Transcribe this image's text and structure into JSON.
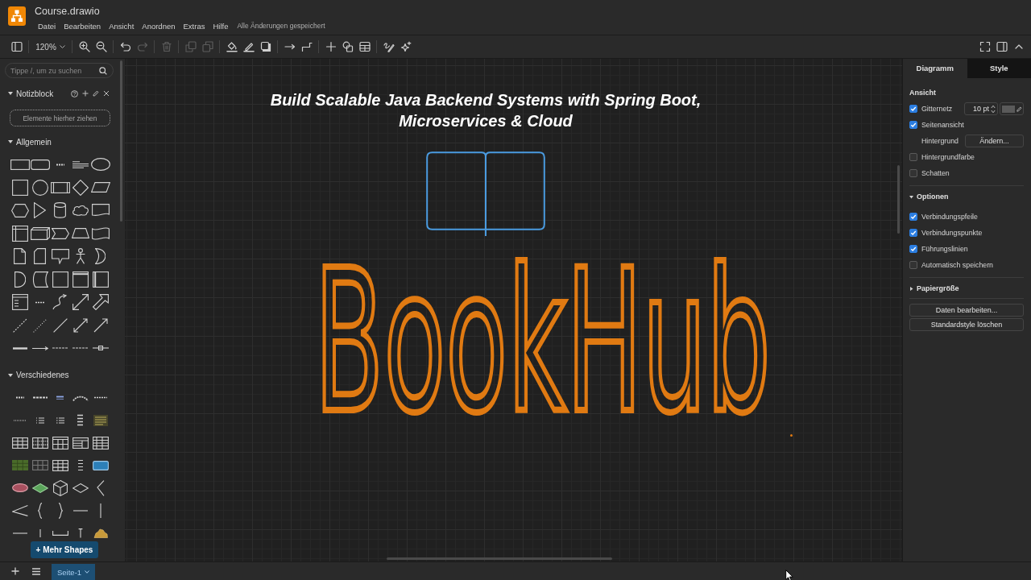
{
  "window": {
    "title": "Course.drawio"
  },
  "menu": [
    "Datei",
    "Bearbeiten",
    "Ansicht",
    "Anordnen",
    "Extras",
    "Hilfe"
  ],
  "save_status": "Alle Änderungen gespeichert",
  "toolbar": {
    "zoom": "120%",
    "items": [
      {
        "disabled": false
      },
      {
        "disabled": false
      },
      {
        "disabled": false
      },
      {
        "disabled": false
      },
      {
        "disabled": true
      },
      {
        "disabled": true
      },
      {
        "disabled": true
      },
      {
        "disabled": true
      },
      {
        "disabled": false
      },
      {
        "disabled": false
      },
      {
        "disabled": false
      },
      {
        "disabled": false
      },
      {
        "disabled": false
      },
      {
        "disabled": false
      },
      {
        "disabled": false
      },
      {
        "disabled": false
      },
      {
        "disabled": false
      },
      {
        "disabled": false
      }
    ],
    "right_items": [
      {
        "disabled": false
      },
      {
        "disabled": false
      },
      {
        "disabled": false
      }
    ]
  },
  "sidebar": {
    "search": {
      "placeholder": "Tippe /, um zu suchen"
    },
    "sections": [
      {
        "kind": "scratchpad",
        "title": "Notizblock",
        "expanded": true,
        "hint": "Elemente hierher ziehen"
      },
      {
        "kind": "shapes",
        "title": "Allgemein",
        "expanded": true
      },
      {
        "kind": "shapes",
        "title": "Verschiedenes",
        "expanded": true
      }
    ],
    "more_button": "+ Mehr Shapes"
  },
  "canvas": {
    "heading": "Build Scalable Java Backend Systems with Spring Boot, Microservices & Cloud",
    "sketch_text": "BookHub"
  },
  "format_panel": {
    "tabs": [
      {
        "label": "Diagramm",
        "selected": true
      },
      {
        "label": "Style",
        "selected": false
      }
    ],
    "view": {
      "title": "Ansicht",
      "rows": [
        {
          "kind": "grid",
          "label": "Gitternetz",
          "checked": true,
          "value": "10 pt"
        },
        {
          "kind": "check",
          "label": "Seitenansicht",
          "checked": true
        },
        {
          "kind": "background",
          "label": "Hintergrund",
          "button": "Ändern..."
        },
        {
          "kind": "check",
          "label": "Hintergrundfarbe",
          "checked": false
        },
        {
          "kind": "check",
          "label": "Schatten",
          "checked": false
        }
      ]
    },
    "sections": [
      {
        "title": "Optionen",
        "expanded": true,
        "rows": [
          {
            "label": "Verbindungspfeile",
            "checked": true
          },
          {
            "label": "Verbindungspunkte",
            "checked": true
          },
          {
            "label": "Führungslinien",
            "checked": true
          },
          {
            "label": "Automatisch speichern",
            "checked": false
          }
        ]
      },
      {
        "title": "Papiergröße",
        "expanded": false
      }
    ],
    "buttons": [
      "Daten bearbeiten...",
      "Standardstyle löschen"
    ]
  },
  "pages": [
    {
      "label": "Seite-1",
      "selected": true
    }
  ]
}
